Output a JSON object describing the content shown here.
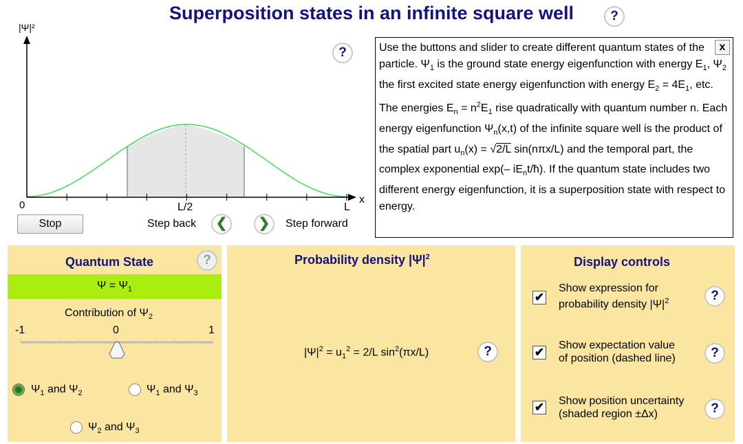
{
  "title": "Superposition states in an infinite square well",
  "graph": {
    "y_axis_label": "|Ψ|²",
    "x_axis_label": "x",
    "tick_0": "0",
    "tick_half": "L/2",
    "tick_L": "L"
  },
  "controls": {
    "stop_label": "Stop",
    "step_back_label": "Step back",
    "step_forward_label": "Step forward",
    "step_back_icon": "chevron-left",
    "step_forward_icon": "chevron-right"
  },
  "info": {
    "close_label": "x",
    "text": "Use the buttons and slider to create different quantum states of the particle. Ψ1 is the ground state energy eigenfunction with energy E1, Ψ2 the first excited state energy eigenfunction with energy E2 = 4E1, etc. The energies En = n2E1 rise quadratically with quantum number n. Each energy eigenfunction Ψn(x,t) of the infinite square well is the product of the spatial part un(x) = √2/L sin(nπx/L) and the temporal part, the complex exponential exp(– iEnt/ħ). If the quantum state includes two different energy eigenfunction, it is a superposition state with respect to energy."
  },
  "quantum_state": {
    "title": "Quantum State",
    "state_display": "Ψ = Ψ1",
    "contribution_label": "Contribution of Ψ2",
    "slider_min": "-1",
    "slider_mid": "0",
    "slider_max": "1",
    "slider_value": 0,
    "options": [
      "Ψ1 and Ψ2",
      "Ψ1 and Ψ3",
      "Ψ2 and Ψ3"
    ],
    "selected_option": "Ψ1 and Ψ2"
  },
  "probability": {
    "title": "Probability density |Ψ|²",
    "expression": "|Ψ|² = u1² = 2/L sin²(πx/L)"
  },
  "display_controls": {
    "title": "Display controls",
    "items": [
      {
        "label_line1": "Show expression for",
        "label_line2": "probability density |Ψ|²",
        "checked": true
      },
      {
        "label_line1": "Show expectation value",
        "label_line2": "of position (dashed line)",
        "checked": true
      },
      {
        "label_line1": "Show position uncertainty",
        "label_line2": "(shaded region ±Δx)",
        "checked": true
      }
    ]
  },
  "help_label": "?",
  "colors": {
    "title": "#131380",
    "curve": "#44dd55",
    "state_bar": "#aaee11",
    "panel_bg": "#fae6a0",
    "shade": "#e6e6e6"
  }
}
